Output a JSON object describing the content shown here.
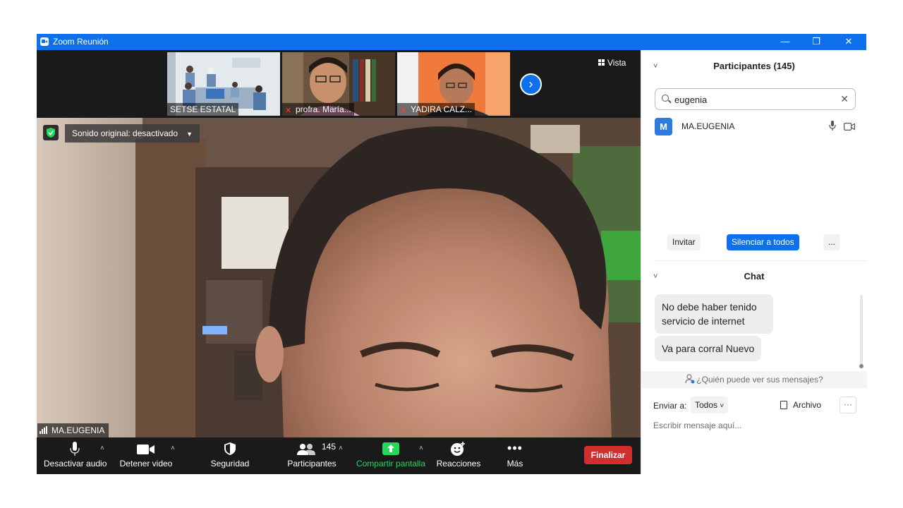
{
  "window": {
    "title": "Zoom Reunión",
    "controls": {
      "minimize": "—",
      "restore": "❐",
      "close": "✕"
    }
  },
  "thumbnails": [
    {
      "name": "SETSE ESTATAL",
      "muted": false
    },
    {
      "name": "profra. María...",
      "muted": true
    },
    {
      "name": "YADIRA CALZ...",
      "muted": true
    }
  ],
  "view_button": {
    "label": "Vista"
  },
  "main_video": {
    "audio_status": "Sonido original: desactivado",
    "speaker_name": "MA.EUGENIA"
  },
  "toolbar": {
    "audio": "Desactivar audio",
    "video": "Detener video",
    "security": "Seguridad",
    "participants": "Participantes",
    "participants_count": "145",
    "share": "Compartir pantalla",
    "reactions": "Reacciones",
    "more": "Más",
    "end": "Finalizar",
    "share_color": "#23d959",
    "end_color": "#d12e2e"
  },
  "participants_panel": {
    "title": "Participantes (145)",
    "search_value": "eugenia",
    "results": [
      {
        "initial": "M",
        "name": "MA.EUGENIA",
        "avatar_color": "#2d7be0"
      }
    ],
    "buttons": {
      "invite": "Invitar",
      "mute_all": "Silenciar a todos",
      "more": "..."
    }
  },
  "chat_panel": {
    "title": "Chat",
    "messages": [
      {
        "text": "No debe haber tenido servicio de internet"
      },
      {
        "text": "Va para corral Nuevo"
      }
    ],
    "who_can_see": "¿Quién puede ver sus mensajes?",
    "send_to_label": "Enviar a:",
    "send_to_value": "Todos",
    "file_label": "Archivo",
    "more": "···",
    "input_placeholder": "Escribir mensaje aquí..."
  }
}
